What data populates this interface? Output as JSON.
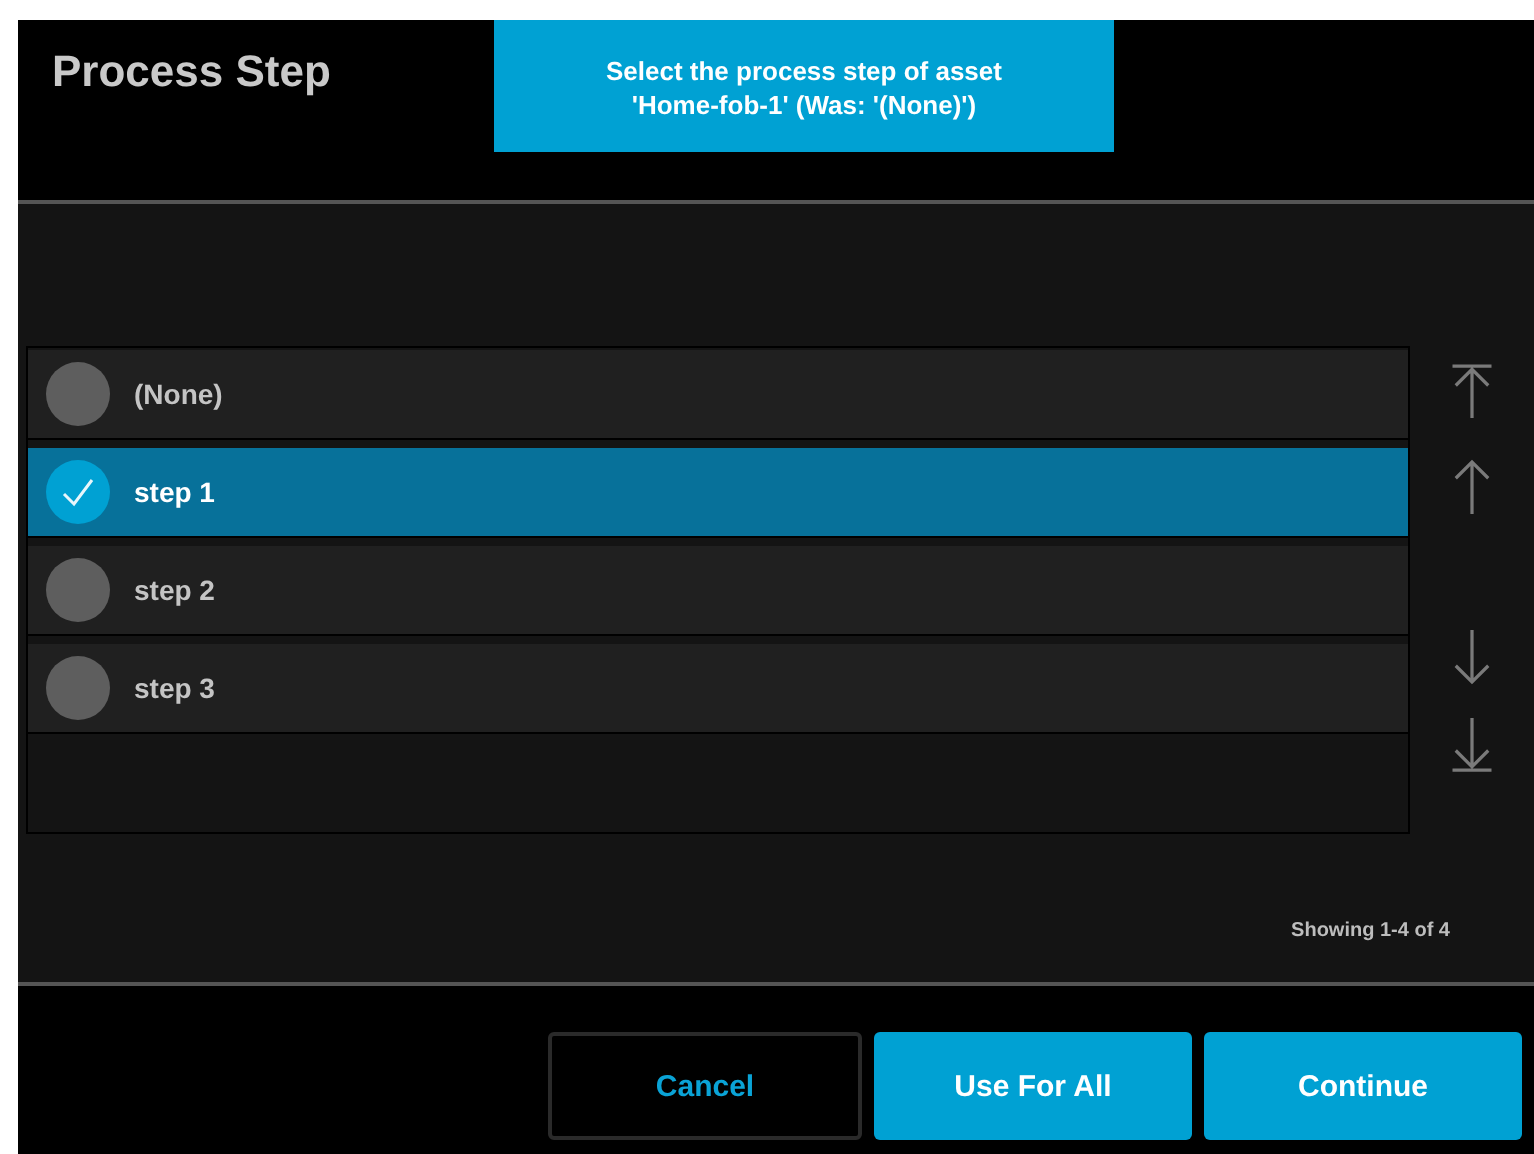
{
  "header": {
    "title": "Process Step",
    "prompt": "Select the process step of asset\n'Home-fob-1' (Was: '(None)')"
  },
  "list": {
    "items": [
      {
        "label": "(None)",
        "selected": false
      },
      {
        "label": "step 1",
        "selected": true
      },
      {
        "label": "step 2",
        "selected": false
      },
      {
        "label": "step 3",
        "selected": false
      }
    ],
    "status": "Showing 1-4 of 4"
  },
  "buttons": [
    {
      "label": "Cancel",
      "kind": "outline"
    },
    {
      "label": "Use For All",
      "kind": "filled"
    },
    {
      "label": "Continue",
      "kind": "filled"
    }
  ]
}
